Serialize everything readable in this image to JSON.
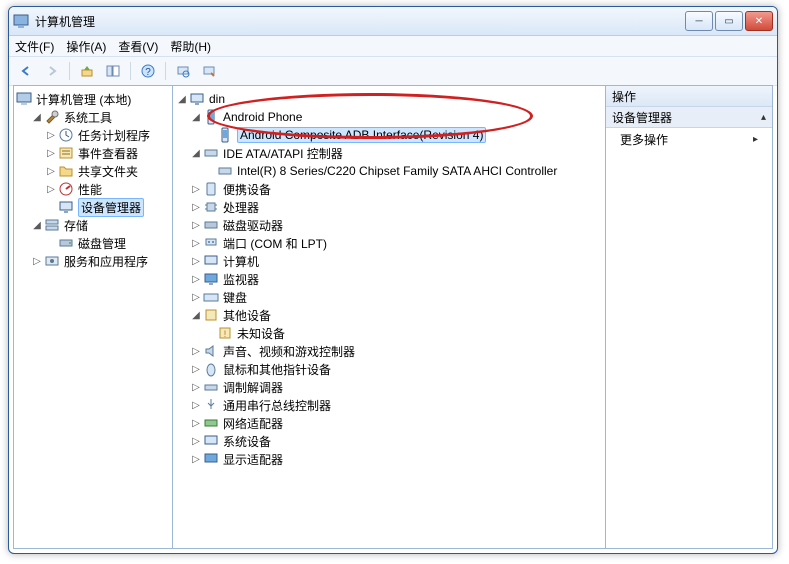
{
  "window": {
    "title": "计算机管理"
  },
  "menu": {
    "file": "文件(F)",
    "action": "操作(A)",
    "view": "查看(V)",
    "help": "帮助(H)"
  },
  "leftTree": {
    "root": "计算机管理 (本地)",
    "systemTools": "系统工具",
    "taskScheduler": "任务计划程序",
    "eventViewer": "事件查看器",
    "sharedFolders": "共享文件夹",
    "performance": "性能",
    "deviceManager": "设备管理器",
    "storage": "存储",
    "diskMgmt": "磁盘管理",
    "services": "服务和应用程序"
  },
  "midTree": {
    "root": "din",
    "androidPhone": "Android Phone",
    "adbInterface": "Android Composite ADB Interface(Revision 4)",
    "ideAta": "IDE ATA/ATAPI 控制器",
    "intel": "Intel(R) 8 Series/C220 Chipset Family SATA AHCI Controller",
    "portable": "便携设备",
    "cpu": "处理器",
    "diskDrives": "磁盘驱动器",
    "ports": "端口 (COM 和 LPT)",
    "computer": "计算机",
    "monitors": "监视器",
    "keyboard": "键盘",
    "otherDevices": "其他设备",
    "unknown": "未知设备",
    "sound": "声音、视频和游戏控制器",
    "mouse": "鼠标和其他指针设备",
    "modem": "调制解调器",
    "usb": "通用串行总线控制器",
    "network": "网络适配器",
    "system": "系统设备",
    "display": "显示适配器"
  },
  "actions": {
    "header": "操作",
    "deviceManager": "设备管理器",
    "more": "更多操作"
  }
}
